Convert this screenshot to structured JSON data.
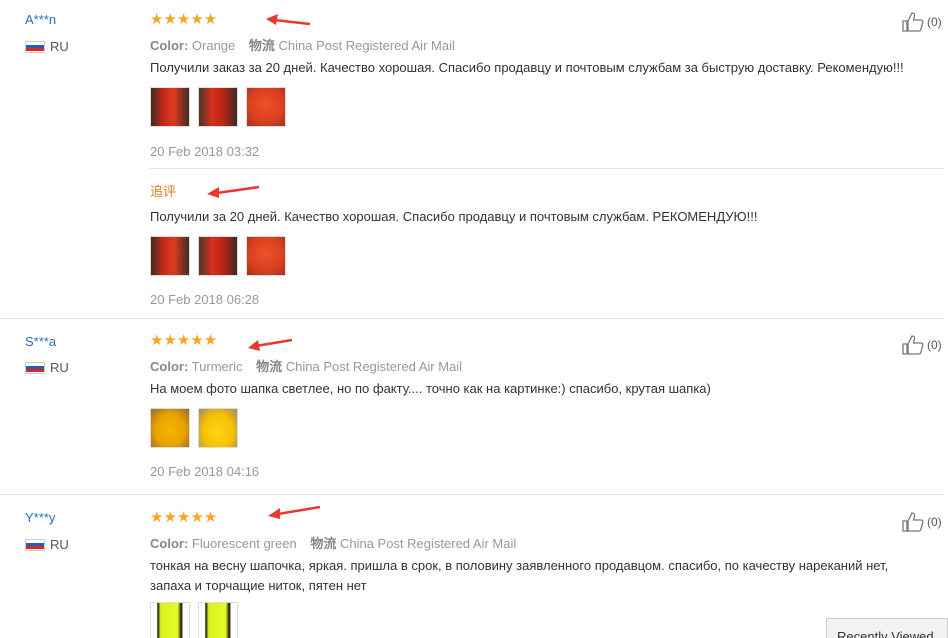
{
  "colors": {
    "star": "#f5a623",
    "username": "#2a6ebb",
    "follow_up": "#e27b1a",
    "arrow": "#e8392f"
  },
  "reviews": [
    {
      "user": "A***n",
      "country": "RU",
      "stars": "★★★★★",
      "color_label": "Color:",
      "color_value": "Orange",
      "logistics_label": "物流",
      "logistics_value": "China Post Registered Air Mail",
      "text": "Получили заказ за 20 дней. Качество хорошая. Спасибо продавцу и почтовым службам за быструю доставку. Рекомендую!!!",
      "date": "20 Feb 2018 03:32",
      "like_count": "(0)",
      "follow_label": "追评",
      "follow_text": "Получили за 20 дней. Качество хорошая. Спасибо продавцу и почтовым службам. РЕКОМЕНДУЮ!!!",
      "follow_date": "20 Feb 2018 06:28"
    },
    {
      "user": "S***a",
      "country": "RU",
      "stars": "★★★★★",
      "color_label": "Color:",
      "color_value": "Turmeric",
      "logistics_label": "物流",
      "logistics_value": "China Post Registered Air Mail",
      "text": "На моем фото шапка светлее, но по факту.... точно как на картинке:) спасибо, крутая шапка)",
      "date": "20 Feb 2018 04:16",
      "like_count": "(0)"
    },
    {
      "user": "Y***y",
      "country": "RU",
      "stars": "★★★★★",
      "color_label": "Color:",
      "color_value": "Fluorescent green",
      "logistics_label": "物流",
      "logistics_value": "China Post Registered Air Mail",
      "text_line1": "тонкая на весну шапочка, яркая. пришла в срок, в половину заявленного продавцом. спасибо, по качеству нареканий нет,",
      "text_line2": "запаха и торчащие ниток, пятен нет",
      "like_count": "(0)"
    }
  ],
  "recently_viewed": "Recently Viewed"
}
